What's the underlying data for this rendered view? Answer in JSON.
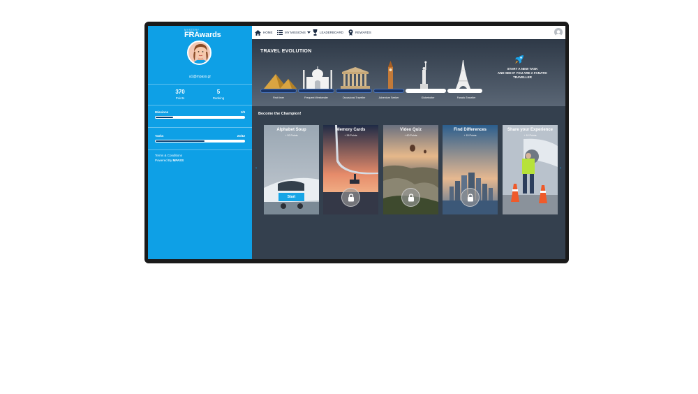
{
  "app": {
    "logo_sub": "MYSTERY",
    "logo_main": "FRAwards"
  },
  "sidebar": {
    "email": "a1@mpass.gr",
    "stats": [
      {
        "value": "370",
        "label": "Points"
      },
      {
        "value": "5",
        "label": "Ranking"
      }
    ],
    "progress": [
      {
        "label": "Missions",
        "count": "1/9",
        "fraction": 0.2
      },
      {
        "label": "Tasks",
        "count": "23/42",
        "fraction": 0.55
      }
    ],
    "footer": {
      "terms": "Terms & Conditions",
      "powered_prefix": "Powered By ",
      "powered_brand": "MPASS"
    }
  },
  "nav": {
    "items": [
      {
        "label": "HOME",
        "icon": "home-icon"
      },
      {
        "label": "MY MISSIONS",
        "icon": "list-icon"
      },
      {
        "label": "LEADERBOARD",
        "icon": "trophy-icon"
      },
      {
        "label": "REWARDS",
        "icon": "medal-icon"
      }
    ]
  },
  "hero": {
    "title": "TRAVEL EVOLUTION",
    "milestones": [
      "First timer",
      "Frequent Weekender",
      "Occasional Traveller",
      "Adventure Seeker",
      "Globetrotter",
      "Fanatic Traveller"
    ],
    "cta_lines": [
      "START A NEW TASK",
      "AND SEE IF YOU ARE A FANATIC",
      "TRAVELLER"
    ]
  },
  "champion": {
    "title": "Become the Champion!",
    "cards": [
      {
        "title": "Alphabet Soup",
        "points": "+ 52 Points",
        "locked": false,
        "button": "Start"
      },
      {
        "title": "Memory Cards",
        "points": "+ 36 Points",
        "locked": true
      },
      {
        "title": "Video Quiz",
        "points": "+ 60 Points",
        "locked": true
      },
      {
        "title": "Find Differences",
        "points": "+ 15 Points",
        "locked": true
      },
      {
        "title": "Share your Experience",
        "points": "+ 10 Points",
        "locked": false
      }
    ]
  },
  "colors": {
    "sidebar": "#0ea0e6",
    "accent": "#16a5e6",
    "progress_fill": "#0b3f6f",
    "background": "#34404e"
  }
}
